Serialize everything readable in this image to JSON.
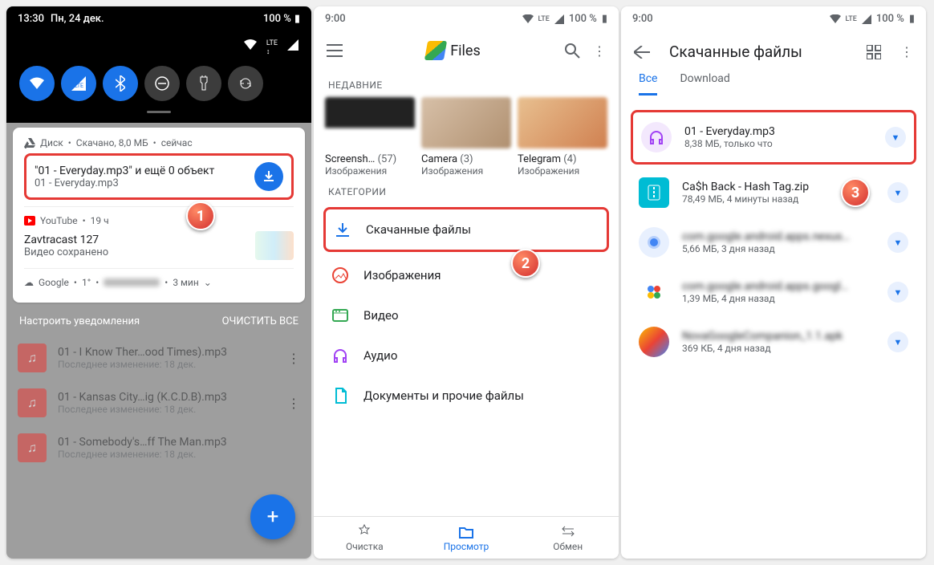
{
  "p1": {
    "time": "13:30",
    "date": "Пн, 24 дек.",
    "battery": "100 %",
    "drive": {
      "app": "Диск",
      "status": "Скачано, 8,0 МБ",
      "when": "сейчас"
    },
    "download": {
      "title": "\"01 - Everyday.mp3\" и ещё 0 объект",
      "sub": "01 - Everyday.mp3"
    },
    "youtube": {
      "app": "YouTube",
      "when": "19 ч",
      "title": "Zavtracast 127",
      "sub": "Видео сохранено"
    },
    "google": {
      "app": "Google",
      "temp": "1°",
      "when": "3 мин"
    },
    "footer": {
      "manage": "Настроить уведомления",
      "clear": "ОЧИСТИТЬ ВСЕ"
    },
    "dim": [
      {
        "title": "01 - I Know Ther…ood Times).mp3",
        "sub": "Последнее изменение: 18 дек."
      },
      {
        "title": "01 - Kansas City…ig (K.C.D.B).mp3",
        "sub": "Последнее изменение: 18 дек."
      },
      {
        "title": "01 - Somebody's…ff The Man.mp3",
        "sub": "Последнее изменение: 18 дек."
      }
    ],
    "marker": "1"
  },
  "p2": {
    "time": "9:00",
    "battery": "100 %",
    "app": "Files",
    "section_recent": "НЕДАВНИЕ",
    "section_cat": "КАТЕГОРИИ",
    "recent": [
      {
        "name": "Screensh…",
        "count": "(57)",
        "sub": "Изображения"
      },
      {
        "name": "Camera",
        "count": "(3)",
        "sub": "Изображения"
      },
      {
        "name": "Telegram",
        "count": "(4)",
        "sub": "Изображения"
      }
    ],
    "cats": {
      "downloads": "Скачанные файлы",
      "images": "Изображения",
      "video": "Видео",
      "audio": "Аудио",
      "docs": "Документы и прочие файлы"
    },
    "nav": {
      "clean": "Очистка",
      "browse": "Просмотр",
      "share": "Обмен"
    },
    "marker": "2"
  },
  "p3": {
    "time": "9:00",
    "battery": "100 %",
    "title": "Скачанные файлы",
    "tabs": {
      "all": "Все",
      "download": "Download"
    },
    "files": [
      {
        "name": "01 - Everyday.mp3",
        "meta": "8,38 МБ, только что"
      },
      {
        "name": "Ca$h Back - Hash Tag.zip",
        "meta": "78,49 МБ, 4 минуты назад"
      },
      {
        "name": "com.google.android.apps.nexus…",
        "meta": "5,66 МБ, 3 дня назад"
      },
      {
        "name": "com.google.android.apps.googl…",
        "meta": "1,39 МБ, 4 дня назад"
      },
      {
        "name": "NovaGoogleCompanion_1.1.apk",
        "meta": "369 КБ, 4 дня назад"
      }
    ],
    "marker": "3"
  }
}
